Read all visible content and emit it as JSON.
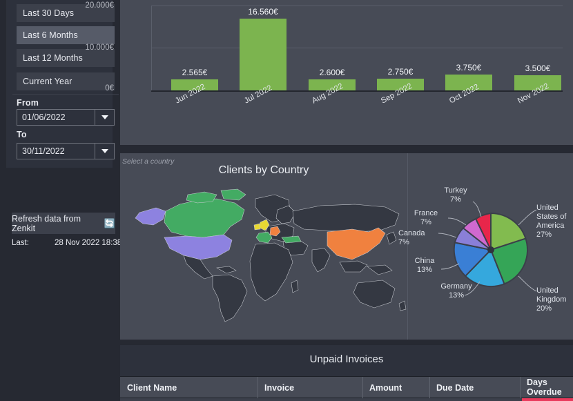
{
  "sidebar": {
    "range_buttons": [
      {
        "label": "Last 30 Days",
        "selected": false
      },
      {
        "label": "Last 6 Months",
        "selected": true
      },
      {
        "label": "Last 12 Months",
        "selected": false
      },
      {
        "label": "Current Year",
        "selected": false
      }
    ],
    "from_label": "From",
    "from_value": "01/06/2022",
    "to_label": "To",
    "to_value": "30/11/2022",
    "refresh_label": "Refresh data from Zenkit",
    "refresh_icon": "refresh-icon",
    "last_label": "Last:",
    "last_value": "28 Nov 2022  18:38"
  },
  "map_panel": {
    "hint": "Select a country",
    "title": "Clients by Country"
  },
  "table": {
    "title": "Unpaid Invoices",
    "columns": [
      "Client Name",
      "Invoice",
      "Amount",
      "Due Date",
      "Days\nOverdue"
    ]
  },
  "colors": {
    "bar_green": "#7cb44f",
    "overdue_red": "#e93a5c",
    "panel_bg": "#474b56",
    "sidebar_bg": "#2d313c",
    "page_bg": "#262932"
  },
  "chart_data": [
    {
      "type": "bar",
      "title": "",
      "categories": [
        "Jun 2022",
        "Jul 2022",
        "Aug 2022",
        "Sep 2022",
        "Oct 2022",
        "Nov 2022"
      ],
      "values": [
        2565,
        16560,
        2600,
        2750,
        3750,
        3500
      ],
      "value_labels": [
        "2.565€",
        "16.560€",
        "2.600€",
        "2.750€",
        "3.750€",
        "3.500€"
      ],
      "ytick_labels": [
        "0€",
        "10.000€",
        "20.000€"
      ],
      "ytick_values": [
        0,
        10000,
        20000
      ],
      "ylim": [
        0,
        20000
      ],
      "xlabel": "",
      "ylabel": "",
      "grid": true,
      "series_color": "#7cb44f"
    },
    {
      "type": "pie",
      "title": "Clients by Country",
      "categories": [
        "United States of America",
        "United Kingdom",
        "Germany",
        "China",
        "Canada",
        "France",
        "Turkey"
      ],
      "values": [
        27,
        20,
        13,
        13,
        7,
        7,
        7
      ],
      "labels": [
        "United\nStates of\nAmerica\n27%",
        "United\nKingdom\n20%",
        "Germany\n13%",
        "China\n13%",
        "Canada\n7%",
        "France\n7%",
        "Turkey\n7%"
      ],
      "colors": [
        "#82bb4f",
        "#35a557",
        "#35a8dd",
        "#3a7fd5",
        "#8a7fd8",
        "#d069cf",
        "#e8264a"
      ],
      "legend": "labels-with-leader-lines"
    },
    {
      "type": "map",
      "title": "Clients by Country",
      "regions": [
        {
          "name": "Canada",
          "color": "#43ab63"
        },
        {
          "name": "United States of America",
          "color": "#8d82e0"
        },
        {
          "name": "United Kingdom",
          "color": "#e8d832"
        },
        {
          "name": "France",
          "color": "#43ab63"
        },
        {
          "name": "Germany",
          "color": "#f0813f"
        },
        {
          "name": "Turkey",
          "color": "#43ab63"
        },
        {
          "name": "China",
          "color": "#f0813f"
        }
      ]
    }
  ]
}
